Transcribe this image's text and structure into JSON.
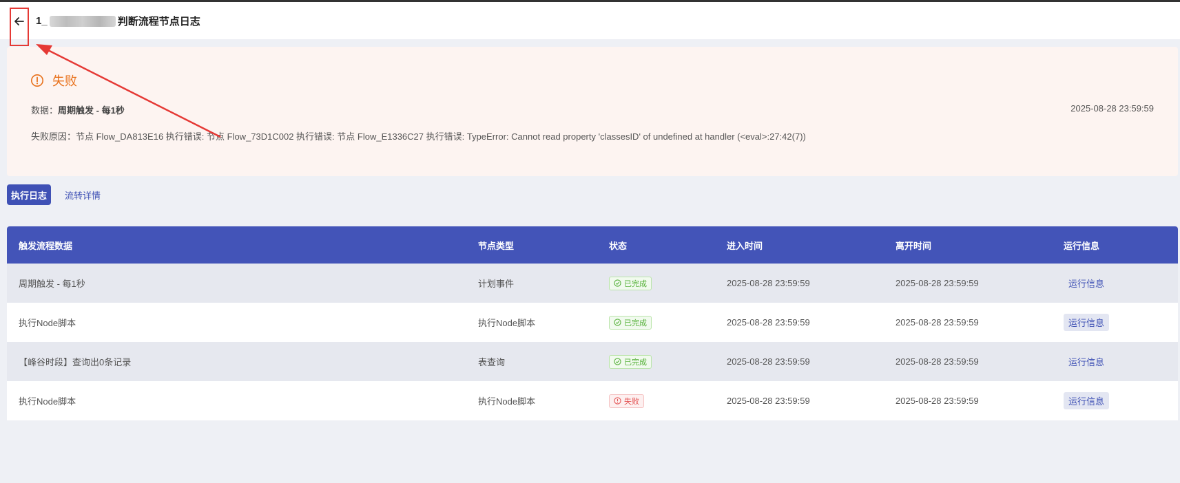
{
  "header": {
    "title_prefix": "1_",
    "title_suffix": "判断流程节点日志"
  },
  "fail_panel": {
    "status": "失败",
    "data_label": "数据：",
    "data_value": "周期触发 - 每1秒",
    "timestamp": "2025-08-28 23:59:59",
    "reason": "失败原因：节点 Flow_DA813E16 执行错误: 节点 Flow_73D1C002 执行错误: 节点 Flow_E1336C27 执行错误: TypeError: Cannot read property 'classesID' of undefined at handler (<eval>:27:42(7))"
  },
  "tabs": {
    "active": "执行日志",
    "other": "流转详情"
  },
  "table": {
    "headers": [
      "触发流程数据",
      "节点类型",
      "状态",
      "进入时间",
      "离开时间",
      "运行信息"
    ],
    "rows": [
      {
        "data": "周期触发 - 每1秒",
        "type": "计划事件",
        "status": "已完成",
        "enter": "2025-08-28 23:59:59",
        "leave": "2025-08-28 23:59:59",
        "info": "运行信息"
      },
      {
        "data": "执行Node脚本",
        "type": "执行Node脚本",
        "status": "已完成",
        "enter": "2025-08-28 23:59:59",
        "leave": "2025-08-28 23:59:59",
        "info": "运行信息"
      },
      {
        "data": "【峰谷时段】查询出0条记录",
        "type": "表查询",
        "status": "已完成",
        "enter": "2025-08-28 23:59:59",
        "leave": "2025-08-28 23:59:59",
        "info": "运行信息"
      },
      {
        "data": "执行Node脚本",
        "type": "执行Node脚本",
        "status": "失败",
        "enter": "2025-08-28 23:59:59",
        "leave": "2025-08-28 23:59:59",
        "info": "运行信息"
      }
    ]
  },
  "colors": {
    "accent": "#3f51b5",
    "fail": "#e8701a",
    "ok": "#56b13a",
    "error": "#e35454",
    "annotation": "#e53935"
  },
  "icons": [
    "back-arrow-icon",
    "warning-circle-icon",
    "check-circle-icon",
    "error-circle-icon"
  ]
}
